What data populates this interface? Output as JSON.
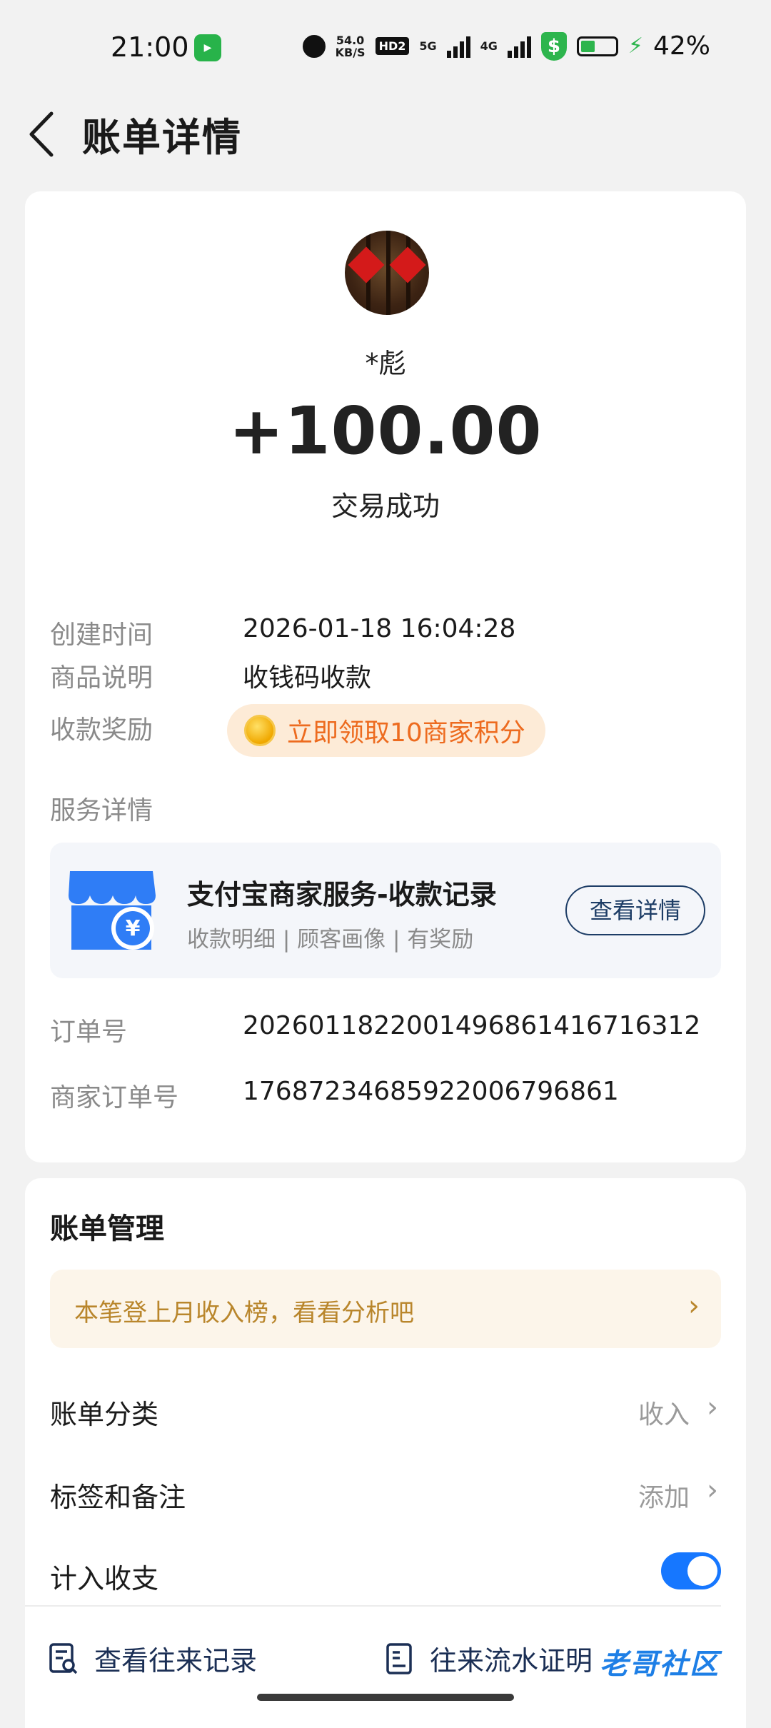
{
  "status_bar": {
    "time": "21:00",
    "net_speed_value": "54.0",
    "net_speed_unit": "KB/S",
    "hd_label": "HD2",
    "sim1_label": "5G",
    "sim2_label": "4G",
    "battery_percent": "42%",
    "battery_level": 0.42,
    "icons": [
      "alarm-icon",
      "hd-icon",
      "signal-icon",
      "shield-icon",
      "battery-icon",
      "charging-icon"
    ]
  },
  "header": {
    "title": "账单详情"
  },
  "transaction": {
    "payer_name": "*彪",
    "amount": "+100.00",
    "status": "交易成功"
  },
  "details": {
    "create_time_label": "创建时间",
    "create_time_value": "2026-01-18 16:04:28",
    "product_label": "商品说明",
    "product_value": "收钱码收款",
    "reward_label": "收款奖励",
    "reward_text": "立即领取10商家积分",
    "service_label": "服务详情",
    "order_label": "订单号",
    "order_value": "2026011822001496861416716312",
    "merchant_order_label": "商家订单号",
    "merchant_order_value": "17687234685922006796861"
  },
  "service": {
    "title": "支付宝商家服务-收款记录",
    "subtitle": "收款明细 | 顾客画像 | 有奖励",
    "button": "查看详情"
  },
  "management": {
    "title": "账单管理",
    "promo": "本笔登上月收入榜，看看分析吧",
    "category_label": "账单分类",
    "category_value": "收入",
    "tags_label": "标签和备注",
    "tags_value": "添加",
    "count_label": "计入收支",
    "count_enabled": true
  },
  "bottom_links": {
    "history": "查看往来记录",
    "proof": "往来流水证明"
  },
  "watermark": "老哥社区",
  "colors": {
    "accent_blue": "#1677ff",
    "reward_orange": "#ed6b1f",
    "promo_gold": "#b9862c",
    "success_green": "#2db54d"
  }
}
